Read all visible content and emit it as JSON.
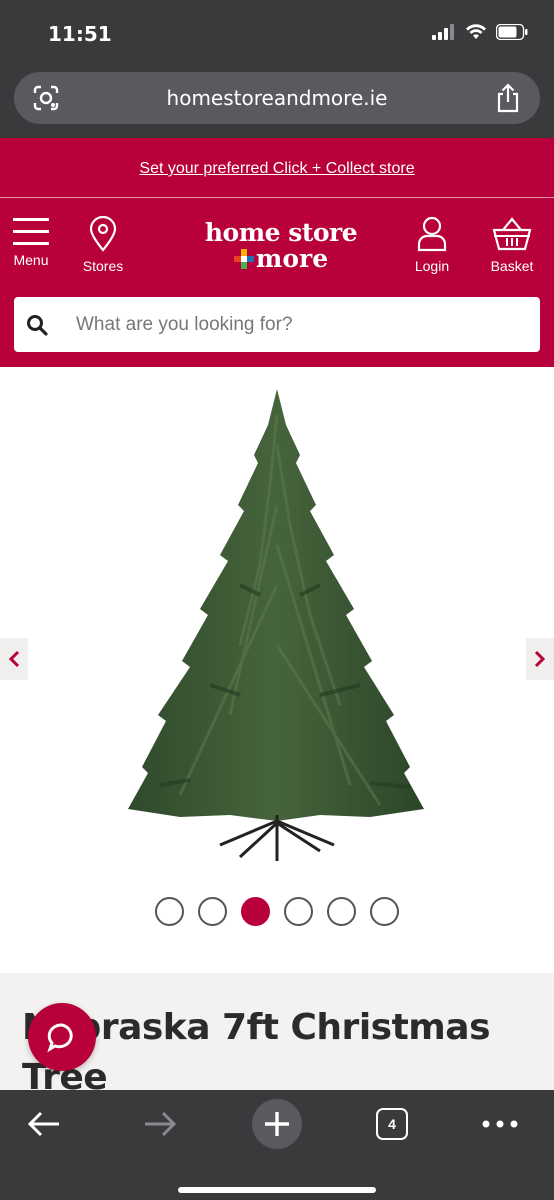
{
  "status_bar": {
    "time": "11:51",
    "icons": [
      "signal-icon",
      "wifi-icon",
      "battery-icon"
    ]
  },
  "browser": {
    "url": "homestoreandmore.ie",
    "icons": [
      "lens-icon",
      "share-icon"
    ],
    "toolbar": {
      "tab_count": "4",
      "icons": [
        "back-arrow-icon",
        "forward-arrow-icon",
        "new-tab-plus-icon",
        "tabs-icon",
        "more-dots-icon"
      ]
    }
  },
  "site": {
    "collect_link": "Set your preferred Click + Collect store",
    "logo": {
      "line1": "home store",
      "line2": "more"
    },
    "nav": {
      "menu": "Menu",
      "stores": "Stores",
      "login": "Login",
      "basket": "Basket"
    },
    "search": {
      "placeholder": "What are you looking for?"
    },
    "colors": {
      "brand": "#b8003a",
      "chrome": "#3a3a3c"
    }
  },
  "gallery": {
    "image": "christmas-tree-image",
    "image_count": 6,
    "active_index": 2,
    "icons": [
      "chevron-left-icon",
      "chevron-right-icon"
    ]
  },
  "product": {
    "title": "Nebraska 7ft Christmas Tree"
  },
  "chat": {
    "icon": "chat-bubble-icon"
  }
}
